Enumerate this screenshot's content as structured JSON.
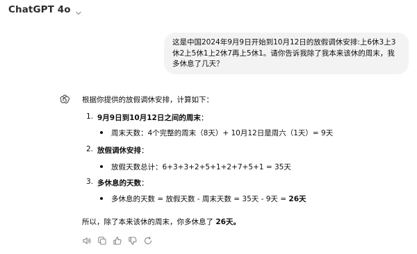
{
  "header": {
    "model_title": "ChatGPT 4o"
  },
  "user_message": {
    "text": "这是中国2024年9月9日开始到10月12日的放假调休安排:上6休3上3休2上5休1上2休7再上5休1。请你告诉我除了我本来该休的周末，我多休息了几天？"
  },
  "assistant_message": {
    "intro": "根据你提供的放假调休安排，计算如下：",
    "items": [
      {
        "number": "1.",
        "heading": "9月9日到10月12日之间的周末",
        "colon": "：",
        "bullet": "周末天数：4个完整的周末（8天）+ 10月12日是周六（1天）= 9天"
      },
      {
        "number": "2.",
        "heading": "放假调休安排",
        "colon": "：",
        "bullet": "放假天数总计：6+3+3+2+5+1+2+7+5+1 = 35天"
      },
      {
        "number": "3.",
        "heading": "多休息的天数",
        "colon": "：",
        "bullet_prefix": "多休息的天数 = 放假天数 - 周末天数 = 35天 - 9天 = ",
        "bullet_strong": "26天"
      }
    ],
    "summary_prefix": "所以，除了本来该休的周末，你多休息了 ",
    "summary_strong": "26天。"
  },
  "toolbar": {
    "icons": [
      "speaker-icon",
      "copy-icon",
      "thumbs-up-icon",
      "thumbs-down-icon",
      "regenerate-icon"
    ]
  },
  "colors": {
    "bubble_bg": "#f3f3f3",
    "icon_gray": "#8a8a8a",
    "text": "#0d0d0d"
  }
}
